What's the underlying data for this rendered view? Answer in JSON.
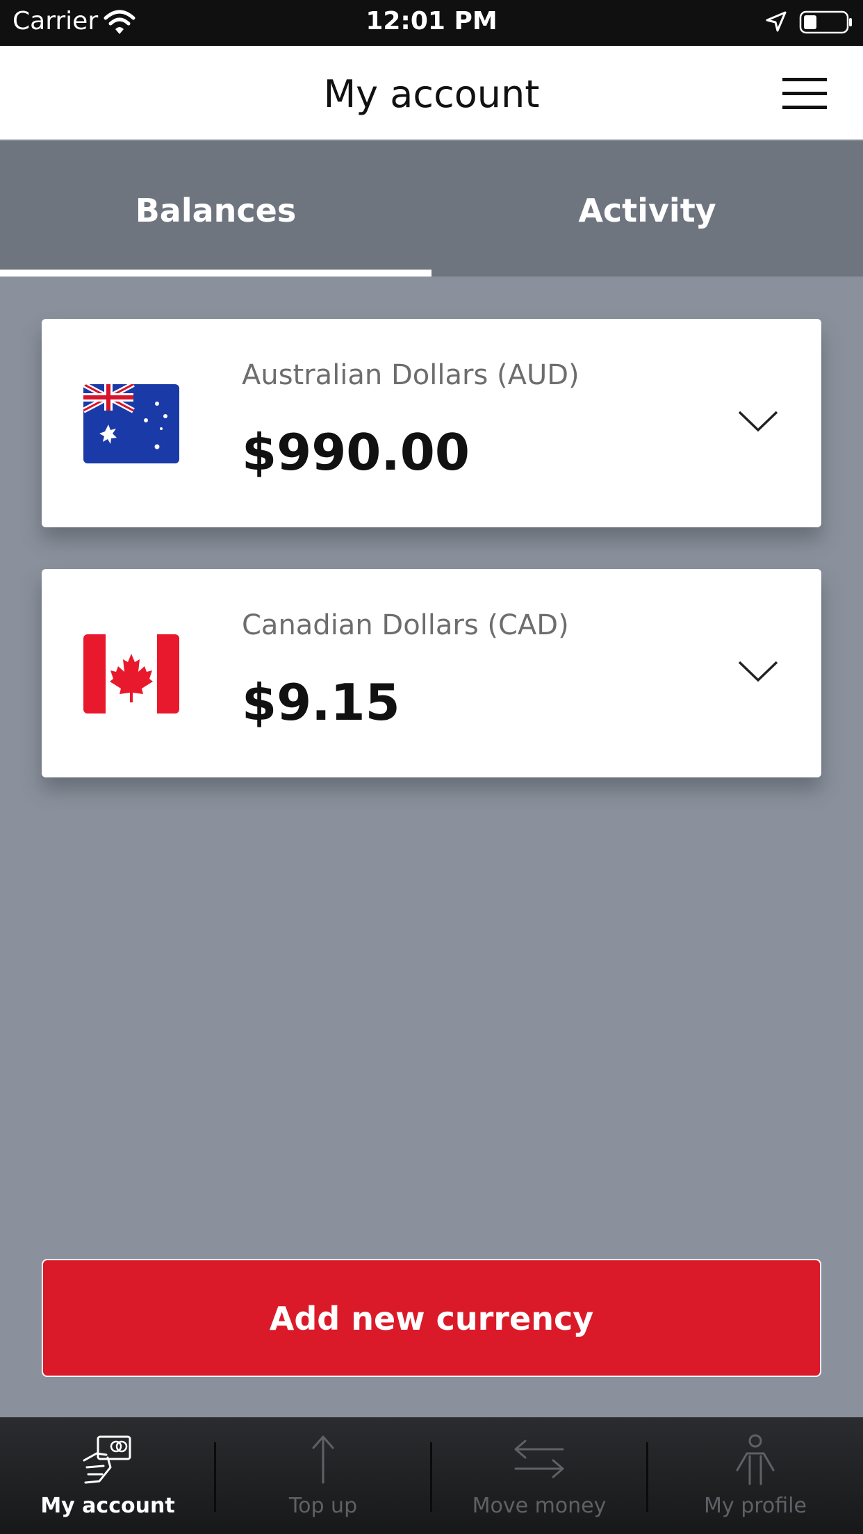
{
  "status_bar": {
    "carrier": "Carrier",
    "time": "12:01 PM"
  },
  "header": {
    "title": "My account"
  },
  "tabs": [
    {
      "label": "Balances",
      "active": true
    },
    {
      "label": "Activity",
      "active": false
    }
  ],
  "balances": [
    {
      "currency": "Australian Dollars (AUD)",
      "amount": "$990.00",
      "flag": "australia-flag"
    },
    {
      "currency": "Canadian Dollars (CAD)",
      "amount": "$9.15",
      "flag": "canada-flag"
    }
  ],
  "add_button": {
    "label": "Add new currency"
  },
  "tab_bar": {
    "items": [
      {
        "label": "My account",
        "icon": "hand-card-icon",
        "active": true
      },
      {
        "label": "Top up",
        "icon": "arrow-up-icon",
        "active": false
      },
      {
        "label": "Move money",
        "icon": "transfer-arrows-icon",
        "active": false
      },
      {
        "label": "My profile",
        "icon": "person-icon",
        "active": false
      }
    ]
  },
  "colors": {
    "brand_red": "#db1a29",
    "page_background": "#8a919c",
    "tab_strip": "#6f757f",
    "tab_bar": "#1f2022"
  }
}
